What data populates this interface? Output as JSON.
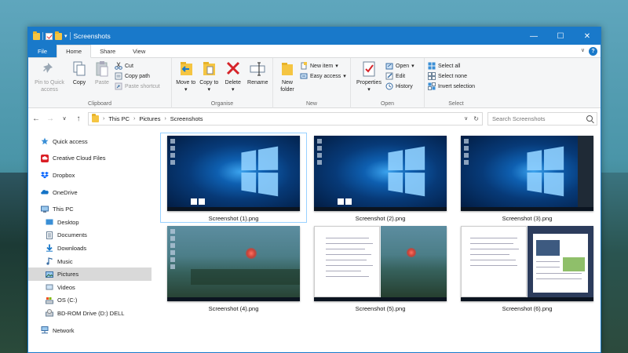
{
  "window": {
    "title": "Screenshots",
    "controls": {
      "minimize": "—",
      "maximize": "☐",
      "close": "✕"
    }
  },
  "tabs": [
    {
      "label": "File"
    },
    {
      "label": "Home"
    },
    {
      "label": "Share"
    },
    {
      "label": "View"
    }
  ],
  "ribbon": {
    "clipboard": {
      "label": "Clipboard",
      "pin": "Pin to Quick access",
      "copy": "Copy",
      "paste": "Paste",
      "cut": "Cut",
      "copy_path": "Copy path",
      "paste_shortcut": "Paste shortcut"
    },
    "organise": {
      "label": "Organise",
      "move_to": "Move to",
      "copy_to": "Copy to",
      "delete": "Delete",
      "rename": "Rename"
    },
    "new": {
      "label": "New",
      "new_folder": "New folder",
      "new_item": "New item",
      "easy_access": "Easy access"
    },
    "open": {
      "label": "Open",
      "properties": "Properties",
      "open": "Open",
      "edit": "Edit",
      "history": "History"
    },
    "select": {
      "label": "Select",
      "select_all": "Select all",
      "select_none": "Select none",
      "invert": "Invert selection"
    }
  },
  "address": {
    "crumbs": [
      "This PC",
      "Pictures",
      "Screenshots"
    ],
    "search_placeholder": "Search Screenshots"
  },
  "nav": {
    "quick_access": "Quick access",
    "creative_cloud": "Creative Cloud Files",
    "dropbox": "Dropbox",
    "onedrive": "OneDrive",
    "this_pc": "This PC",
    "desktop": "Desktop",
    "documents": "Documents",
    "downloads": "Downloads",
    "music": "Music",
    "pictures": "Pictures",
    "videos": "Videos",
    "os_c": "OS (C:)",
    "bd_rom": "BD-ROM Drive (D:) DELL",
    "network": "Network"
  },
  "files": [
    {
      "name": "Screenshot (1).png"
    },
    {
      "name": "Screenshot (2).png"
    },
    {
      "name": "Screenshot (3).png"
    },
    {
      "name": "Screenshot (4).png"
    },
    {
      "name": "Screenshot (5).png"
    },
    {
      "name": "Screenshot (6).png"
    }
  ],
  "colors": {
    "accent": "#1979ca",
    "selection": "#cce8ff",
    "nav_selected": "#d9d9d9"
  }
}
